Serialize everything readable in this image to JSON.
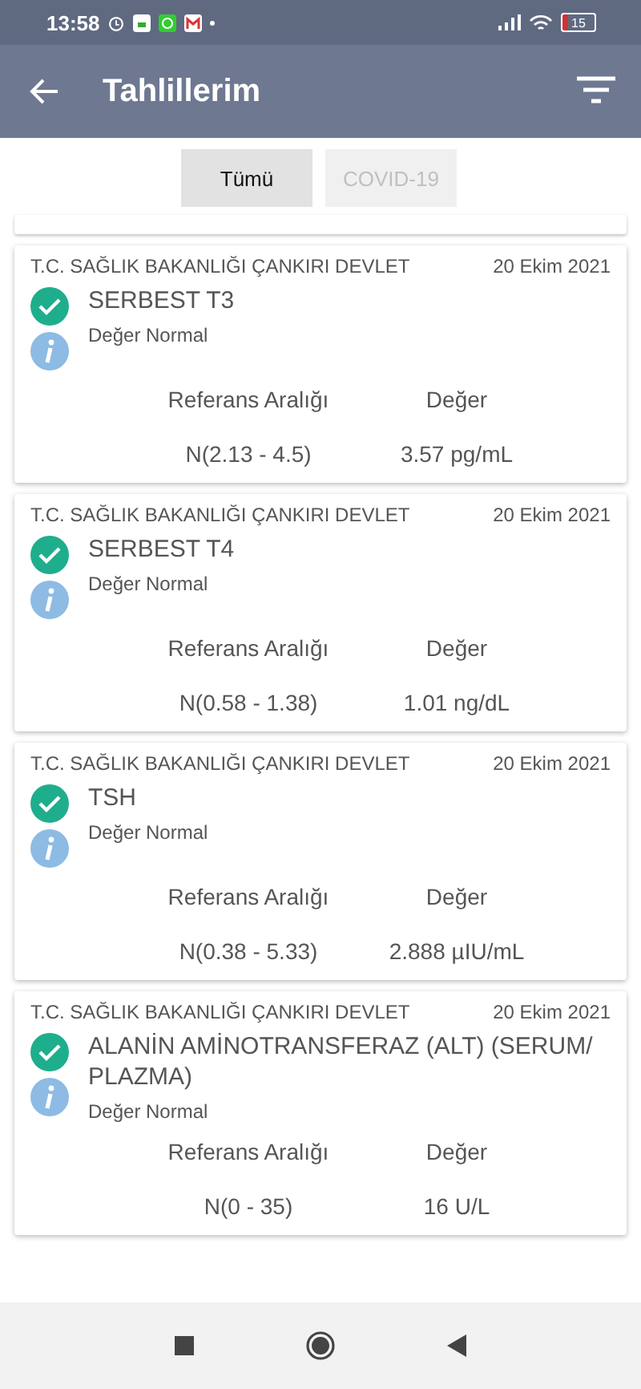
{
  "status_bar": {
    "time": "13:58",
    "battery": "15"
  },
  "app_bar": {
    "title": "Tahlillerim"
  },
  "tabs": [
    {
      "label": "Tümü",
      "selected": true,
      "disabled": false
    },
    {
      "label": "COVID-19",
      "selected": false,
      "disabled": true
    }
  ],
  "results": [
    {
      "institution": "T.C. SAĞLIK BAKANLIĞI ÇANKIRI DEVLET",
      "date": "20 Ekim 2021",
      "test": "SERBEST T3",
      "status": "Değer Normal",
      "normal": true,
      "range_label": "Referans Aralığı",
      "value_label": "Değer",
      "range": "N(2.13 - 4.5)",
      "value": "3.57 pg/mL"
    },
    {
      "institution": "T.C. SAĞLIK BAKANLIĞI ÇANKIRI DEVLET",
      "date": "20 Ekim 2021",
      "test": "SERBEST T4",
      "status": "Değer Normal",
      "normal": true,
      "range_label": "Referans Aralığı",
      "value_label": "Değer",
      "range": "N(0.58 - 1.38)",
      "value": "1.01 ng/dL"
    },
    {
      "institution": "T.C. SAĞLIK BAKANLIĞI ÇANKIRI DEVLET",
      "date": "20 Ekim 2021",
      "test": "TSH",
      "status": "Değer Normal",
      "normal": true,
      "range_label": "Referans Aralığı",
      "value_label": "Değer",
      "range": "N(0.38 - 5.33)",
      "value": "2.888 µIU/mL"
    },
    {
      "institution": "T.C. SAĞLIK BAKANLIĞI ÇANKIRI DEVLET",
      "date": "20 Ekim 2021",
      "test": "ALANİN AMİNOTRANSFERAZ (ALT) (SERUM/ PLAZMA)",
      "status": "Değer Normal",
      "normal": true,
      "range_label": "Referans Aralığı",
      "value_label": "Değer",
      "range": "N(0 - 35)",
      "value": "16 U/L"
    }
  ]
}
